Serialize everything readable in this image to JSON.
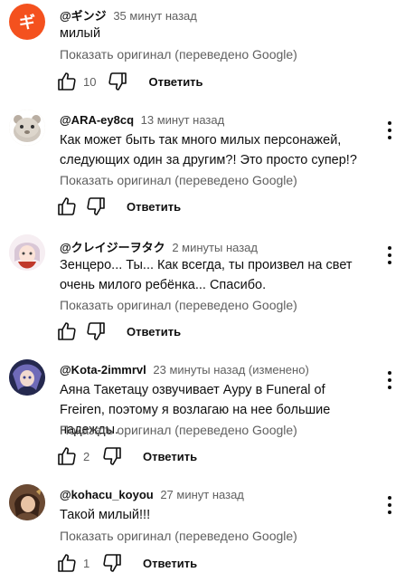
{
  "comments": [
    {
      "handle": "@ギンジ",
      "time": "35 минут назад",
      "text": "милый",
      "translate": "Показать оригинал (переведено Google)",
      "likes": "10",
      "reply": "Ответить",
      "avatar_letter": "ギ",
      "avatar_color": "#f4511e"
    },
    {
      "handle": "@ARA-ey8cq",
      "time": "13 минут назад",
      "text": "Как может быть так много милых персонажей, следующих один за другим?! Это просто супер!?",
      "translate": "Показать оригинал (переведено Google)",
      "likes": "",
      "reply": "Ответить"
    },
    {
      "handle": "@クレイジーヲタク",
      "time": "2 минуты назад",
      "text": "Зенцеро... Ты... Как всегда, ты произвел на свет очень милого ребёнка... Спасибо.",
      "translate": "Показать оригинал (переведено Google)",
      "likes": "",
      "reply": "Ответить"
    },
    {
      "handle": "@Kota-2immrvl",
      "time": "23 минуты назад (изменено)",
      "text": "Аяна Такетацу озвучивает Ауру в Funeral of Freiren, поэтому я возлагаю на нее большие надежды.",
      "translate": "Показать оригинал (переведено Google)",
      "likes": "2",
      "reply": "Ответить"
    },
    {
      "handle": "@kohacu_koyou",
      "time": "27 минут назад",
      "text": "Такой милый!!!",
      "translate": "Показать оригинал (переведено Google)",
      "likes": "1",
      "reply": "Ответить"
    }
  ]
}
